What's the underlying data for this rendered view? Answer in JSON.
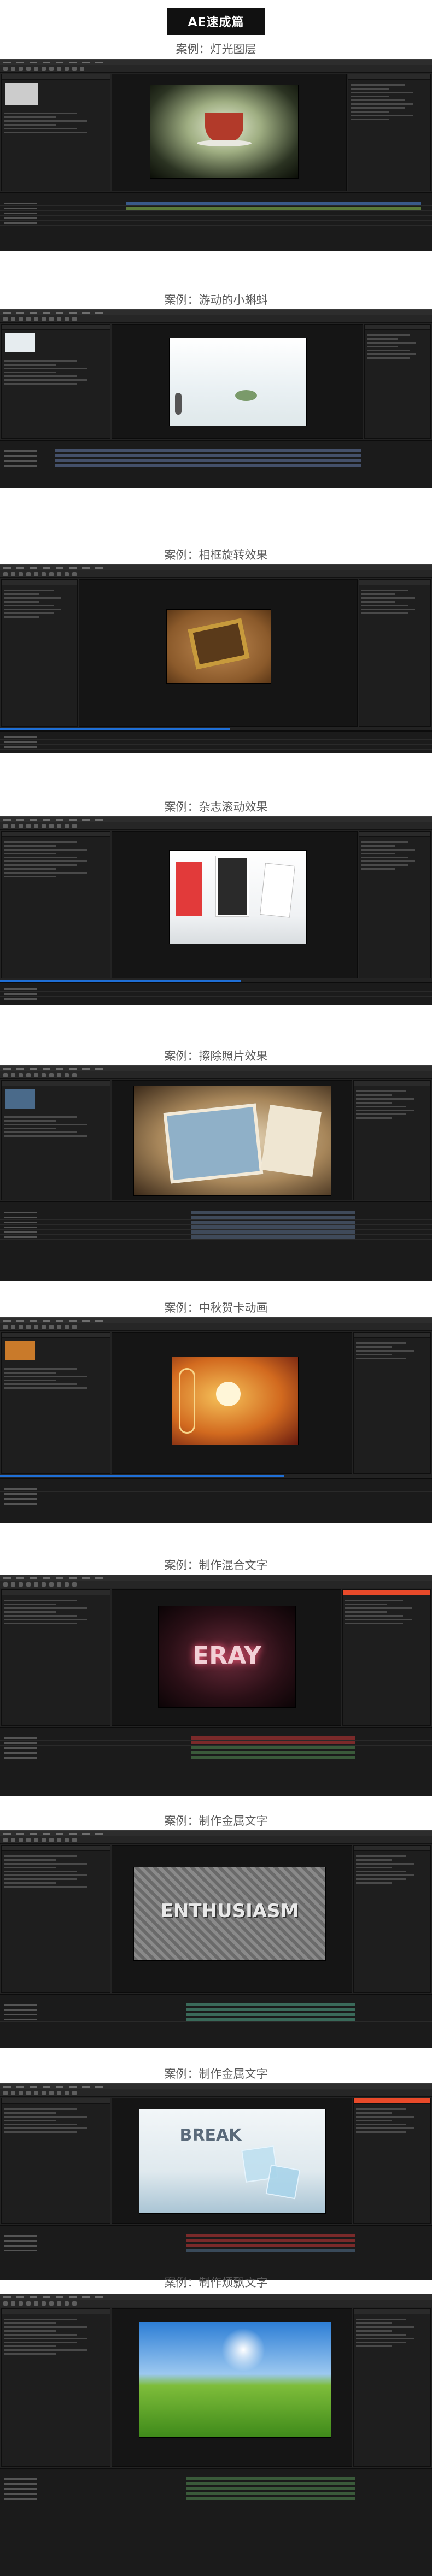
{
  "header": {
    "badge": "AE速成篇"
  },
  "cases": [
    {
      "title": "案例：灯光图层"
    },
    {
      "title": "案例：游动的小蝌蚪"
    },
    {
      "title": "案例：相框旋转效果"
    },
    {
      "title": "案例：杂志滚动效果"
    },
    {
      "title": "案例：擦除照片效果"
    },
    {
      "title": "案例：中秋贺卡动画"
    },
    {
      "title": "案例：制作混合文字"
    },
    {
      "title": "案例：制作金属文字"
    },
    {
      "title": "案例：制作金属文字"
    },
    {
      "title": "案例：制作烦飘文字"
    }
  ],
  "frame_texts": {
    "eray": "ERAY",
    "enthusiasm": "ENTHUSIASM",
    "break": "BREAK"
  },
  "colors": {
    "ui_bg": "#232323",
    "accent_blue": "#1f6fd6",
    "title_gray": "#5a5a5a"
  }
}
